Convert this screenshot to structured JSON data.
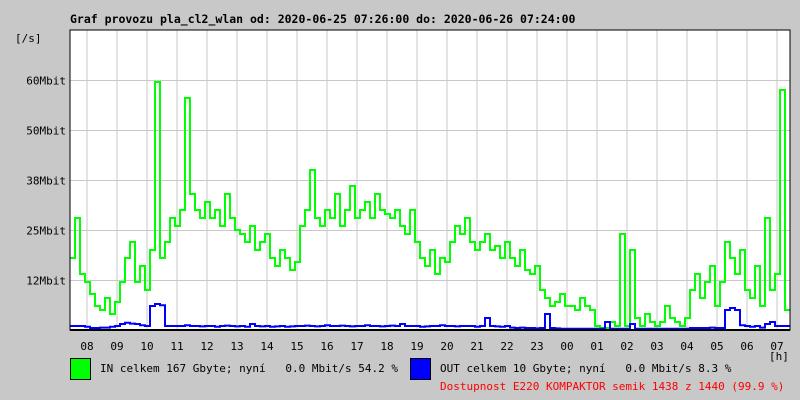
{
  "chart_data": {
    "type": "line",
    "title": "Graf provozu pla_cl2_wlan od: 2020-06-25 07:26:00 do: 2020-06-26 07:24:00",
    "ylabel": "[/s]",
    "xlabel": "[h]",
    "ylim": [
      0,
      75
    ],
    "y_ticks": [
      {
        "value": 12.5,
        "label": "12Mbit"
      },
      {
        "value": 25,
        "label": "25Mbit"
      },
      {
        "value": 37.5,
        "label": "38Mbit"
      },
      {
        "value": 50,
        "label": "50Mbit"
      },
      {
        "value": 62.5,
        "label": "60Mbit"
      }
    ],
    "x_start_minutes": 446,
    "x_span_minutes": 1440,
    "step_minutes": 10,
    "x_ticks": [
      "08",
      "09",
      "10",
      "11",
      "12",
      "13",
      "14",
      "15",
      "16",
      "17",
      "18",
      "19",
      "20",
      "21",
      "22",
      "23",
      "00",
      "01",
      "02",
      "03",
      "04",
      "05",
      "06",
      "07"
    ],
    "grid": true,
    "series": [
      {
        "name": "IN",
        "color": "#00ff00",
        "values": [
          18,
          28,
          14,
          12,
          9,
          6,
          5,
          8,
          4,
          7,
          12,
          18,
          22,
          12,
          16,
          10,
          20,
          62,
          18,
          22,
          28,
          26,
          30,
          58,
          34,
          30,
          28,
          32,
          28,
          30,
          26,
          34,
          28,
          25,
          24,
          22,
          26,
          20,
          22,
          24,
          18,
          16,
          20,
          18,
          15,
          17,
          26,
          30,
          40,
          28,
          26,
          30,
          28,
          34,
          26,
          30,
          36,
          28,
          30,
          32,
          28,
          34,
          30,
          29,
          28,
          30,
          26,
          24,
          30,
          22,
          18,
          16,
          20,
          14,
          18,
          17,
          22,
          26,
          24,
          28,
          22,
          20,
          22,
          24,
          20,
          21,
          18,
          22,
          18,
          16,
          20,
          15,
          14,
          16,
          10,
          8,
          6,
          7,
          9,
          6,
          6,
          5,
          8,
          6,
          5,
          1,
          0.5,
          0.5,
          2,
          1,
          24,
          1,
          20,
          3,
          1,
          4,
          2,
          1,
          2,
          6,
          3,
          2,
          1,
          3,
          10,
          14,
          8,
          12,
          16,
          6,
          12,
          22,
          18,
          14,
          20,
          10,
          8,
          16,
          6,
          28,
          10,
          14,
          60,
          5
        ]
      },
      {
        "name": "OUT",
        "color": "#0000ff",
        "values": [
          1,
          1,
          1,
          0.8,
          0.5,
          0.5,
          0.6,
          0.6,
          0.8,
          1,
          1.5,
          1.8,
          1.6,
          1.5,
          1.2,
          1,
          6,
          6.5,
          6.2,
          1,
          1,
          1,
          1,
          1.2,
          1,
          1,
          0.9,
          1,
          1,
          0.8,
          1,
          1.1,
          1,
          0.9,
          1,
          0.8,
          1.5,
          1,
          0.9,
          1,
          0.8,
          0.9,
          1,
          0.8,
          0.9,
          1,
          1,
          1.1,
          1,
          0.9,
          1,
          1.2,
          1,
          1,
          1.1,
          1,
          0.9,
          1,
          1,
          1.2,
          1,
          1,
          0.9,
          1,
          1.1,
          1,
          1.5,
          1,
          1,
          1,
          0.8,
          0.9,
          1,
          1,
          1.2,
          1,
          1,
          0.9,
          1,
          1,
          1,
          0.8,
          1,
          3,
          1,
          0.9,
          0.8,
          1,
          0.6,
          0.5,
          0.6,
          0.5,
          0.5,
          0.4,
          0.5,
          4,
          0.5,
          0.4,
          0.3,
          0.3,
          0.3,
          0.3,
          0.3,
          0.3,
          0.3,
          0.3,
          0.3,
          2,
          0.3,
          0.3,
          0.3,
          0.3,
          1.5,
          0.3,
          0.3,
          0.3,
          0.3,
          0.3,
          0.3,
          0.3,
          0.3,
          0.3,
          0.3,
          0.3,
          0.5,
          0.5,
          0.5,
          0.5,
          0.6,
          0.5,
          0.5,
          5,
          5.5,
          5,
          1.2,
          1,
          0.8,
          1,
          0.6,
          1.5,
          2,
          1,
          1,
          1,
          1
        ]
      }
    ]
  },
  "legend": {
    "in": {
      "text": "IN celkem 167 Gbyte; nyní   0.0 Mbit/s 54.2 %",
      "color": "#00ff00"
    },
    "out": {
      "text": "OUT celkem 10 Gbyte; nyní   0.0 Mbit/s 8.3 %",
      "color": "#0000ff"
    },
    "availability": "Dostupnost E220 KOMPAKTOR semik 1438 z 1440 (99.9 %)"
  }
}
